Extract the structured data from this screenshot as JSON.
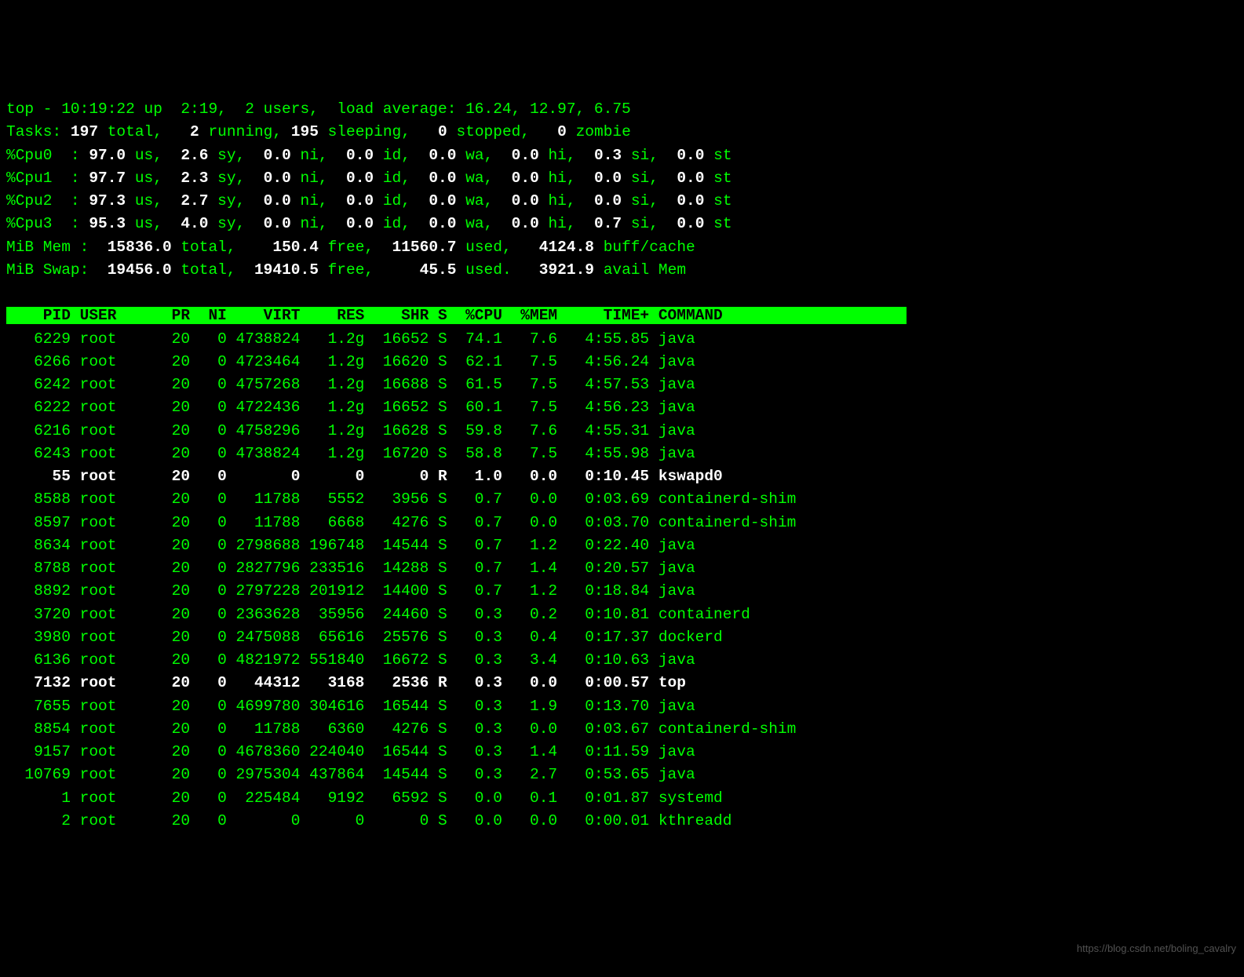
{
  "summary": {
    "line1_a": "top - 10:19:22 up  2:19,  2 users,  load average: 16.24, 12.97, 6.75",
    "tasks_label": "Tasks:",
    "tasks_total": " 197 ",
    "tasks_totlbl": "total,",
    "tasks_run": "   2 ",
    "tasks_runlbl": "running,",
    "tasks_sleep": " 195 ",
    "tasks_sleeplbl": "sleeping,",
    "tasks_stop": "   0 ",
    "tasks_stoplbl": "stopped,",
    "tasks_zomb": "   0 ",
    "tasks_zomblbl": "zombie",
    "cpus": [
      {
        "lbl": "%Cpu0  :",
        "us": " 97.0 ",
        "sy": "  2.6 ",
        "ni": "  0.0 ",
        "id": "  0.0 ",
        "wa": "  0.0 ",
        "hi": "  0.0 ",
        "si": "  0.3 ",
        "st": "  0.0 "
      },
      {
        "lbl": "%Cpu1  :",
        "us": " 97.7 ",
        "sy": "  2.3 ",
        "ni": "  0.0 ",
        "id": "  0.0 ",
        "wa": "  0.0 ",
        "hi": "  0.0 ",
        "si": "  0.0 ",
        "st": "  0.0 "
      },
      {
        "lbl": "%Cpu2  :",
        "us": " 97.3 ",
        "sy": "  2.7 ",
        "ni": "  0.0 ",
        "id": "  0.0 ",
        "wa": "  0.0 ",
        "hi": "  0.0 ",
        "si": "  0.0 ",
        "st": "  0.0 "
      },
      {
        "lbl": "%Cpu3  :",
        "us": " 95.3 ",
        "sy": "  4.0 ",
        "ni": "  0.0 ",
        "id": "  0.0 ",
        "wa": "  0.0 ",
        "hi": "  0.0 ",
        "si": "  0.7 ",
        "st": "  0.0 "
      }
    ],
    "cpu_sfx": {
      "us": "us,",
      "sy": "sy,",
      "ni": "ni,",
      "id": "id,",
      "wa": "wa,",
      "hi": "hi,",
      "si": "si,",
      "st": "st"
    },
    "mem_lbl": "MiB Mem :",
    "mem_total": "  15836.0 ",
    "mem_totlbl": "total,",
    "mem_free": "    150.4 ",
    "mem_freelbl": "free,",
    "mem_used": "  11560.7 ",
    "mem_usedlbl": "used,",
    "mem_buff": "   4124.8 ",
    "mem_bufflbl": "buff/cache",
    "swp_lbl": "MiB Swap:",
    "swp_total": "  19456.0 ",
    "swp_totlbl": "total,",
    "swp_free": "  19410.5 ",
    "swp_freelbl": "free,",
    "swp_used": "     45.5 ",
    "swp_usedlbl": "used.",
    "swp_avail": "   3921.9 ",
    "swp_availlbl": "avail Mem"
  },
  "columns": [
    "PID",
    "USER",
    "PR",
    "NI",
    "VIRT",
    "RES",
    "SHR",
    "S",
    "%CPU",
    "%MEM",
    "TIME+",
    "COMMAND"
  ],
  "header_text": "    PID USER      PR  NI    VIRT    RES    SHR S  %CPU  %MEM     TIME+ COMMAND                    ",
  "processes": [
    {
      "pid": "6229",
      "user": "root",
      "pr": "20",
      "ni": "0",
      "virt": "4738824",
      "res": "1.2g",
      "shr": "16652",
      "s": "S",
      "cpu": "74.1",
      "mem": "7.6",
      "time": "4:55.85",
      "cmd": "java",
      "bold": false
    },
    {
      "pid": "6266",
      "user": "root",
      "pr": "20",
      "ni": "0",
      "virt": "4723464",
      "res": "1.2g",
      "shr": "16620",
      "s": "S",
      "cpu": "62.1",
      "mem": "7.5",
      "time": "4:56.24",
      "cmd": "java",
      "bold": false
    },
    {
      "pid": "6242",
      "user": "root",
      "pr": "20",
      "ni": "0",
      "virt": "4757268",
      "res": "1.2g",
      "shr": "16688",
      "s": "S",
      "cpu": "61.5",
      "mem": "7.5",
      "time": "4:57.53",
      "cmd": "java",
      "bold": false
    },
    {
      "pid": "6222",
      "user": "root",
      "pr": "20",
      "ni": "0",
      "virt": "4722436",
      "res": "1.2g",
      "shr": "16652",
      "s": "S",
      "cpu": "60.1",
      "mem": "7.5",
      "time": "4:56.23",
      "cmd": "java",
      "bold": false
    },
    {
      "pid": "6216",
      "user": "root",
      "pr": "20",
      "ni": "0",
      "virt": "4758296",
      "res": "1.2g",
      "shr": "16628",
      "s": "S",
      "cpu": "59.8",
      "mem": "7.6",
      "time": "4:55.31",
      "cmd": "java",
      "bold": false
    },
    {
      "pid": "6243",
      "user": "root",
      "pr": "20",
      "ni": "0",
      "virt": "4738824",
      "res": "1.2g",
      "shr": "16720",
      "s": "S",
      "cpu": "58.8",
      "mem": "7.5",
      "time": "4:55.98",
      "cmd": "java",
      "bold": false
    },
    {
      "pid": "55",
      "user": "root",
      "pr": "20",
      "ni": "0",
      "virt": "0",
      "res": "0",
      "shr": "0",
      "s": "R",
      "cpu": "1.0",
      "mem": "0.0",
      "time": "0:10.45",
      "cmd": "kswapd0",
      "bold": true
    },
    {
      "pid": "8588",
      "user": "root",
      "pr": "20",
      "ni": "0",
      "virt": "11788",
      "res": "5552",
      "shr": "3956",
      "s": "S",
      "cpu": "0.7",
      "mem": "0.0",
      "time": "0:03.69",
      "cmd": "containerd-shim",
      "bold": false
    },
    {
      "pid": "8597",
      "user": "root",
      "pr": "20",
      "ni": "0",
      "virt": "11788",
      "res": "6668",
      "shr": "4276",
      "s": "S",
      "cpu": "0.7",
      "mem": "0.0",
      "time": "0:03.70",
      "cmd": "containerd-shim",
      "bold": false
    },
    {
      "pid": "8634",
      "user": "root",
      "pr": "20",
      "ni": "0",
      "virt": "2798688",
      "res": "196748",
      "shr": "14544",
      "s": "S",
      "cpu": "0.7",
      "mem": "1.2",
      "time": "0:22.40",
      "cmd": "java",
      "bold": false
    },
    {
      "pid": "8788",
      "user": "root",
      "pr": "20",
      "ni": "0",
      "virt": "2827796",
      "res": "233516",
      "shr": "14288",
      "s": "S",
      "cpu": "0.7",
      "mem": "1.4",
      "time": "0:20.57",
      "cmd": "java",
      "bold": false
    },
    {
      "pid": "8892",
      "user": "root",
      "pr": "20",
      "ni": "0",
      "virt": "2797228",
      "res": "201912",
      "shr": "14400",
      "s": "S",
      "cpu": "0.7",
      "mem": "1.2",
      "time": "0:18.84",
      "cmd": "java",
      "bold": false
    },
    {
      "pid": "3720",
      "user": "root",
      "pr": "20",
      "ni": "0",
      "virt": "2363628",
      "res": "35956",
      "shr": "24460",
      "s": "S",
      "cpu": "0.3",
      "mem": "0.2",
      "time": "0:10.81",
      "cmd": "containerd",
      "bold": false
    },
    {
      "pid": "3980",
      "user": "root",
      "pr": "20",
      "ni": "0",
      "virt": "2475088",
      "res": "65616",
      "shr": "25576",
      "s": "S",
      "cpu": "0.3",
      "mem": "0.4",
      "time": "0:17.37",
      "cmd": "dockerd",
      "bold": false
    },
    {
      "pid": "6136",
      "user": "root",
      "pr": "20",
      "ni": "0",
      "virt": "4821972",
      "res": "551840",
      "shr": "16672",
      "s": "S",
      "cpu": "0.3",
      "mem": "3.4",
      "time": "0:10.63",
      "cmd": "java",
      "bold": false
    },
    {
      "pid": "7132",
      "user": "root",
      "pr": "20",
      "ni": "0",
      "virt": "44312",
      "res": "3168",
      "shr": "2536",
      "s": "R",
      "cpu": "0.3",
      "mem": "0.0",
      "time": "0:00.57",
      "cmd": "top",
      "bold": true
    },
    {
      "pid": "7655",
      "user": "root",
      "pr": "20",
      "ni": "0",
      "virt": "4699780",
      "res": "304616",
      "shr": "16544",
      "s": "S",
      "cpu": "0.3",
      "mem": "1.9",
      "time": "0:13.70",
      "cmd": "java",
      "bold": false
    },
    {
      "pid": "8854",
      "user": "root",
      "pr": "20",
      "ni": "0",
      "virt": "11788",
      "res": "6360",
      "shr": "4276",
      "s": "S",
      "cpu": "0.3",
      "mem": "0.0",
      "time": "0:03.67",
      "cmd": "containerd-shim",
      "bold": false
    },
    {
      "pid": "9157",
      "user": "root",
      "pr": "20",
      "ni": "0",
      "virt": "4678360",
      "res": "224040",
      "shr": "16544",
      "s": "S",
      "cpu": "0.3",
      "mem": "1.4",
      "time": "0:11.59",
      "cmd": "java",
      "bold": false
    },
    {
      "pid": "10769",
      "user": "root",
      "pr": "20",
      "ni": "0",
      "virt": "2975304",
      "res": "437864",
      "shr": "14544",
      "s": "S",
      "cpu": "0.3",
      "mem": "2.7",
      "time": "0:53.65",
      "cmd": "java",
      "bold": false
    },
    {
      "pid": "1",
      "user": "root",
      "pr": "20",
      "ni": "0",
      "virt": "225484",
      "res": "9192",
      "shr": "6592",
      "s": "S",
      "cpu": "0.0",
      "mem": "0.1",
      "time": "0:01.87",
      "cmd": "systemd",
      "bold": false
    },
    {
      "pid": "2",
      "user": "root",
      "pr": "20",
      "ni": "0",
      "virt": "0",
      "res": "0",
      "shr": "0",
      "s": "S",
      "cpu": "0.0",
      "mem": "0.0",
      "time": "0:00.01",
      "cmd": "kthreadd",
      "bold": false
    }
  ],
  "watermark": "https://blog.csdn.net/boling_cavalry"
}
